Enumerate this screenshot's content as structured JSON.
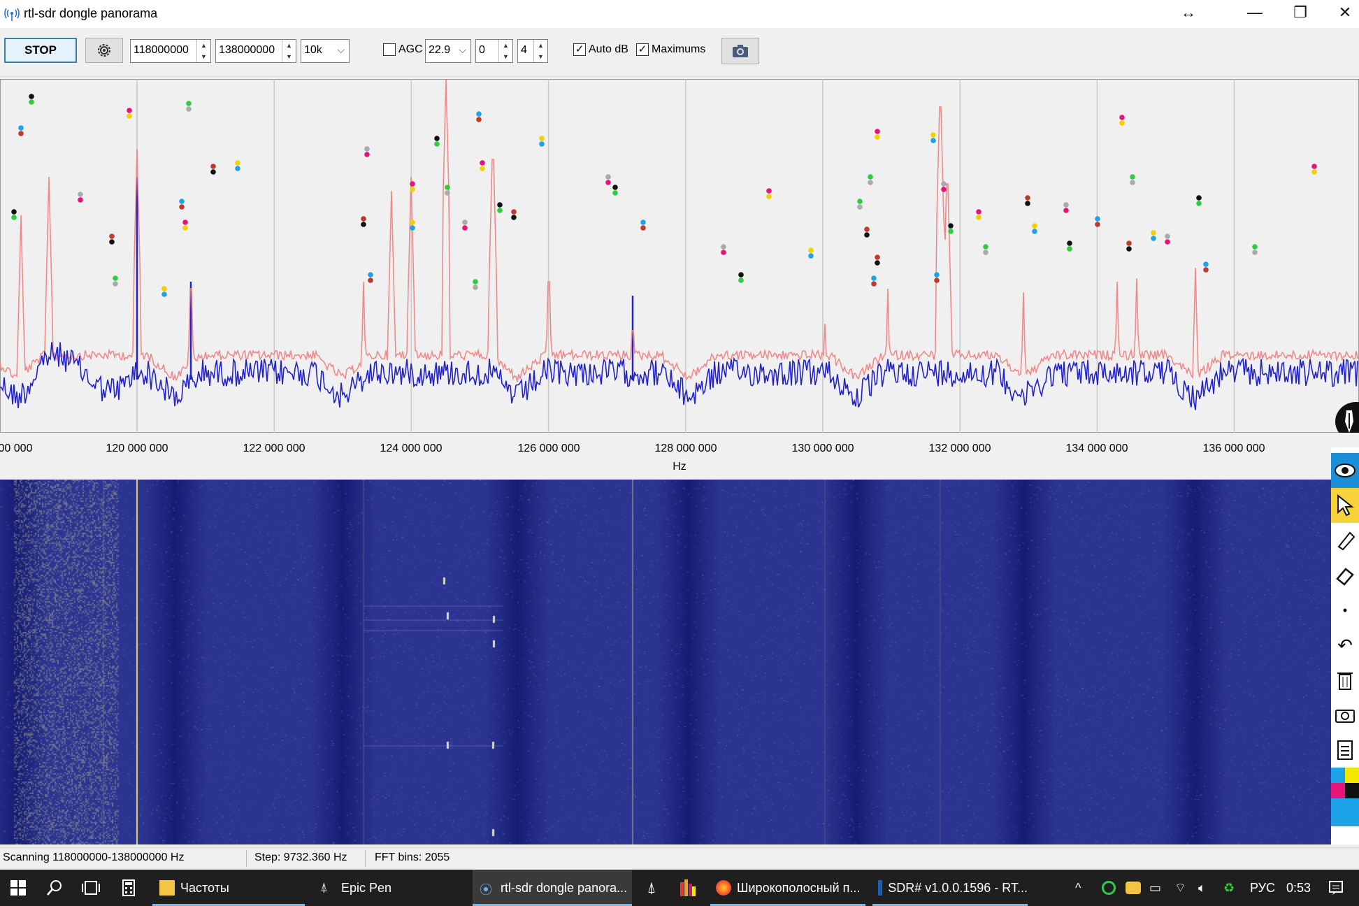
{
  "window": {
    "title": "rtl-sdr dongle panorama",
    "controls": [
      "↔",
      "—",
      "❐",
      "✕"
    ]
  },
  "toolbar": {
    "stop_label": "STOP",
    "start_freq": "118000000",
    "end_freq": "138000000",
    "step": "10k",
    "agc_label": "AGC",
    "agc_checked": false,
    "gain": "22.9",
    "offset": "0",
    "averaging": "4",
    "autodb_label": "Auto dB",
    "autodb_checked": true,
    "maximums_label": "Maximums",
    "maximums_checked": true
  },
  "axis": {
    "unit": "Hz",
    "ticks": [
      "00 000",
      "120 000 000",
      "122 000 000",
      "124 000 000",
      "126 000 000",
      "128 000 000",
      "130 000 000",
      "132 000 000",
      "134 000 000",
      "136 000 000"
    ]
  },
  "colors": {
    "spectrum_line": "#2222cc",
    "max_line": "#f08a8a",
    "waterfall_bg": "#2b3490",
    "grid": "#c8c8c8"
  },
  "status": {
    "scanning": "Scanning 118000000-138000000 Hz",
    "step": "Step: 9732.360 Hz",
    "fft": "FFT bins: 2055"
  },
  "taskbar": {
    "tasks": [
      {
        "label": "Частоты"
      },
      {
        "label": "Epic Pen"
      },
      {
        "label": "rtl-sdr dongle panora..."
      },
      {
        "label": "Широкополосный п..."
      },
      {
        "label": "SDR# v1.0.0.1596 - RT..."
      }
    ],
    "lang": "РУС",
    "time": "0:53"
  },
  "right_tools": [
    "eye-icon",
    "cursor-icon",
    "pen-icon",
    "eraser-icon",
    "dot-icon",
    "undo-icon",
    "trash-icon",
    "camera-icon",
    "list-icon",
    "color-palette-icon"
  ]
}
